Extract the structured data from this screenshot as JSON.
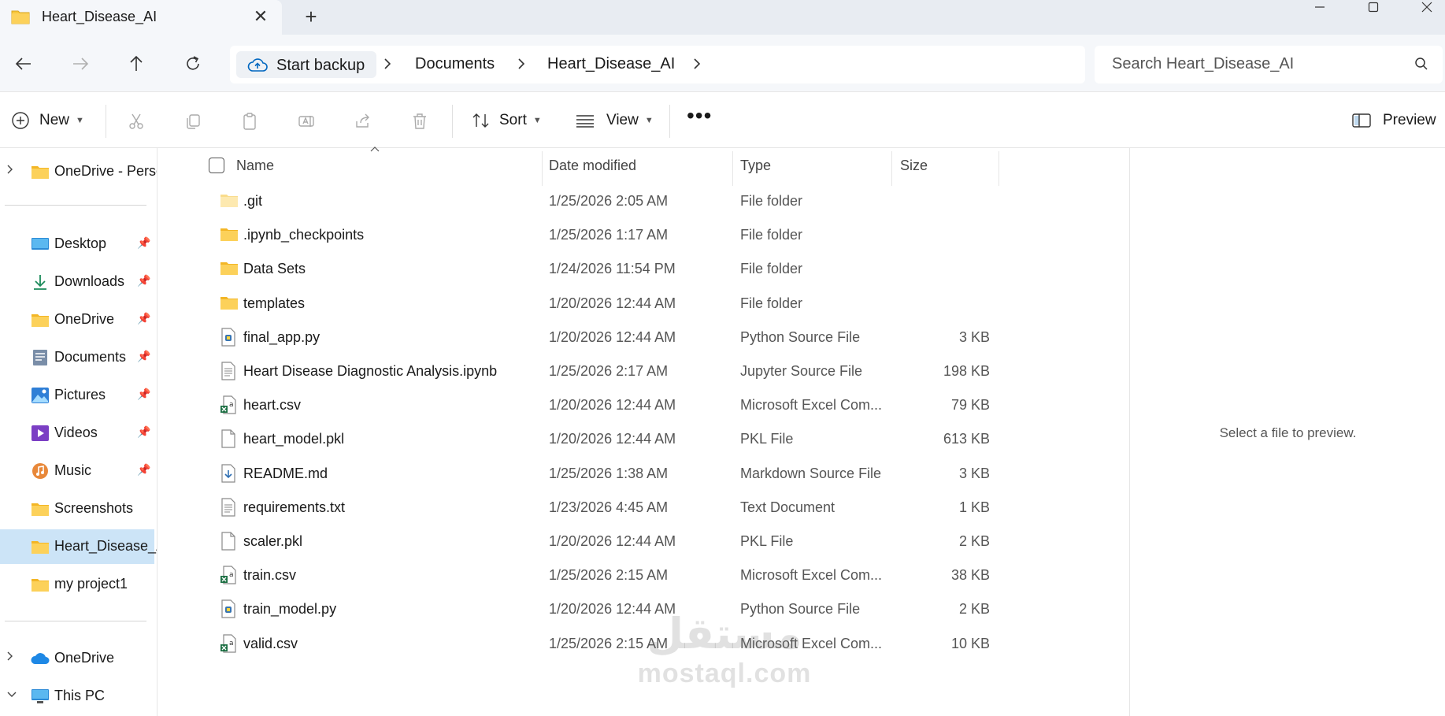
{
  "tab": {
    "title": "Heart_Disease_AI",
    "close": "✕",
    "new": "+"
  },
  "window_controls": {
    "minimize": "—",
    "maximize": "☐",
    "close": "✕"
  },
  "address": {
    "backup_label": "Start backup",
    "crumbs": [
      "Documents",
      "Heart_Disease_AI"
    ]
  },
  "search": {
    "placeholder": "Search Heart_Disease_AI"
  },
  "toolbar": {
    "new_label": "New",
    "sort_label": "Sort",
    "view_label": "View",
    "more_label": "•••",
    "preview_label": "Preview"
  },
  "sidebar": {
    "items": [
      {
        "label": "OneDrive - Perso",
        "icon": "folder-icon"
      },
      {
        "label": "Desktop",
        "icon": "desktop-icon"
      },
      {
        "label": "Downloads",
        "icon": "download-icon"
      },
      {
        "label": "OneDrive",
        "icon": "folder-icon"
      },
      {
        "label": "Documents",
        "icon": "documents-icon"
      },
      {
        "label": "Pictures",
        "icon": "pictures-icon"
      },
      {
        "label": "Videos",
        "icon": "videos-icon"
      },
      {
        "label": "Music",
        "icon": "music-icon"
      },
      {
        "label": "Screenshots",
        "icon": "folder-icon"
      },
      {
        "label": "Heart_Disease_A",
        "icon": "folder-icon"
      },
      {
        "label": "my project1",
        "icon": "folder-icon"
      },
      {
        "label": "OneDrive",
        "icon": "cloud-icon"
      },
      {
        "label": "This PC",
        "icon": "pc-icon"
      }
    ]
  },
  "columns": {
    "name": "Name",
    "date": "Date modified",
    "type": "Type",
    "size": "Size"
  },
  "files": [
    {
      "name": ".git",
      "date": "1/25/2026 2:05 AM",
      "type": "File folder",
      "size": "",
      "icon": "folder-light"
    },
    {
      "name": ".ipynb_checkpoints",
      "date": "1/25/2026 1:17 AM",
      "type": "File folder",
      "size": "",
      "icon": "folder"
    },
    {
      "name": "Data Sets",
      "date": "1/24/2026 11:54 PM",
      "type": "File folder",
      "size": "",
      "icon": "folder"
    },
    {
      "name": "templates",
      "date": "1/20/2026 12:44 AM",
      "type": "File folder",
      "size": "",
      "icon": "folder"
    },
    {
      "name": "final_app.py",
      "date": "1/20/2026 12:44 AM",
      "type": "Python Source File",
      "size": "3 KB",
      "icon": "python"
    },
    {
      "name": "Heart Disease Diagnostic Analysis.ipynb",
      "date": "1/25/2026 2:17 AM",
      "type": "Jupyter Source File",
      "size": "198 KB",
      "icon": "text"
    },
    {
      "name": "heart.csv",
      "date": "1/20/2026 12:44 AM",
      "type": "Microsoft Excel Com...",
      "size": "79 KB",
      "icon": "excel"
    },
    {
      "name": "heart_model.pkl",
      "date": "1/20/2026 12:44 AM",
      "type": "PKL File",
      "size": "613 KB",
      "icon": "blank"
    },
    {
      "name": "README.md",
      "date": "1/25/2026 1:38 AM",
      "type": "Markdown Source File",
      "size": "3 KB",
      "icon": "markdown"
    },
    {
      "name": "requirements.txt",
      "date": "1/23/2026 4:45 AM",
      "type": "Text Document",
      "size": "1 KB",
      "icon": "text"
    },
    {
      "name": "scaler.pkl",
      "date": "1/20/2026 12:44 AM",
      "type": "PKL File",
      "size": "2 KB",
      "icon": "blank"
    },
    {
      "name": "train.csv",
      "date": "1/25/2026 2:15 AM",
      "type": "Microsoft Excel Com...",
      "size": "38 KB",
      "icon": "excel"
    },
    {
      "name": "train_model.py",
      "date": "1/20/2026 12:44 AM",
      "type": "Python Source File",
      "size": "2 KB",
      "icon": "python"
    },
    {
      "name": "valid.csv",
      "date": "1/25/2026 2:15 AM",
      "type": "Microsoft Excel Com...",
      "size": "10 KB",
      "icon": "excel"
    }
  ],
  "preview": {
    "message": "Select a file to preview."
  },
  "watermark": {
    "arabic": "مستقل",
    "latin": "mostaql.com"
  },
  "colors": {
    "accent": "#0067c0",
    "folder": "#f8c73e",
    "selected": "#cce4f7",
    "excel": "#1d7044"
  }
}
